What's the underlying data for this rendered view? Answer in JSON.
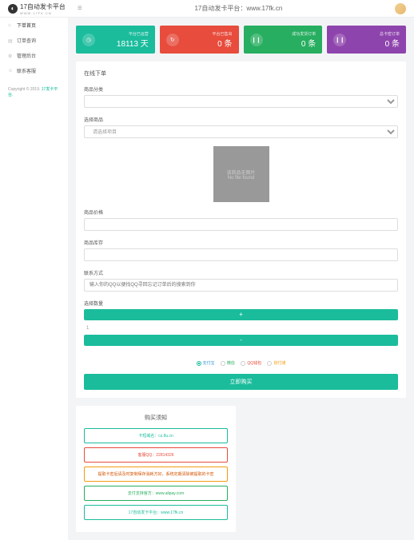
{
  "header": {
    "brand": "17自动发卡平台",
    "brand_sub": "WWW.17FK.CN",
    "title": "17自动发卡平台：www.17fk.cn"
  },
  "nav": {
    "items": [
      {
        "label": "下单首页"
      },
      {
        "label": "订单查询"
      },
      {
        "label": "管理后台"
      },
      {
        "label": "联系客服"
      }
    ]
  },
  "copyright": {
    "prefix": "Copyright © 2019.",
    "link": "17发卡平台."
  },
  "cards": [
    {
      "label": "平台已运营",
      "value": "18113 天"
    },
    {
      "label": "平台已售出",
      "value": "0 条"
    },
    {
      "label": "成功发货订单",
      "value": "0 条"
    },
    {
      "label": "总卡密订单",
      "value": "0 条"
    }
  ],
  "panel": {
    "title": "在线下单"
  },
  "fields": {
    "category": {
      "label": "商品分类"
    },
    "product": {
      "label": "选择商品",
      "placeholder": "请选择项目"
    },
    "noimg": {
      "line1": "该商品无图片",
      "line2": "No file found"
    },
    "price": {
      "label": "商品价格"
    },
    "stock": {
      "label": "商品库存"
    },
    "contact": {
      "label": "联系方式",
      "placeholder": "输入你的QQ以便找QQ寻回忘记订单后的搜索到你"
    },
    "qty": {
      "label": "选择数量",
      "plus": "+",
      "value": "1",
      "minus": "-"
    }
  },
  "payments": [
    {
      "label": "支付宝",
      "checked": true,
      "cls": "pay-blue"
    },
    {
      "label": "微信",
      "checked": false,
      "cls": "pay-green"
    },
    {
      "label": "QQ钱包",
      "checked": false,
      "cls": "pay-red"
    },
    {
      "label": "财付通",
      "checked": false,
      "cls": "pay-orange"
    }
  ],
  "submit": "立即购买",
  "notice": {
    "title": "购买须知",
    "items": [
      {
        "text": "卡短域名：cs.8u.cn",
        "cls": "n-teal"
      },
      {
        "text": "客服QQ：22814326",
        "cls": "n-red"
      },
      {
        "text": "提取卡密后请及时复制保存消耗方好，系统定期清除被提取的卡密",
        "cls": "n-orange"
      },
      {
        "text": "支付支持官方：www.alipay.com",
        "cls": "n-green"
      },
      {
        "text": "17自动发卡平台：www.17fk.cn",
        "cls": "n-teal"
      }
    ]
  }
}
